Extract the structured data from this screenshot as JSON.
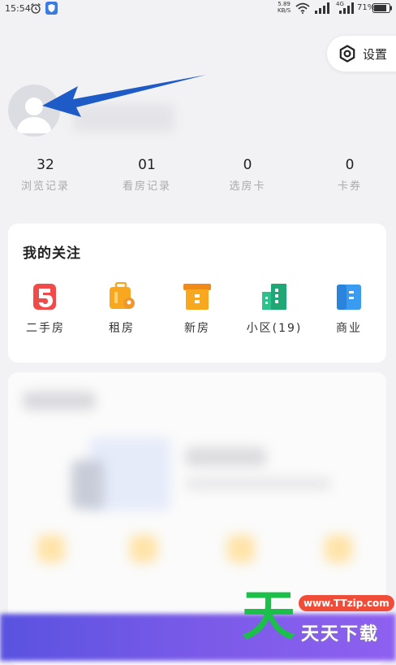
{
  "status_bar": {
    "time": "15:54",
    "net_speed_value": "5.89",
    "net_speed_unit": "KB/S",
    "network_2": "4G",
    "battery": "71%"
  },
  "header": {
    "settings_label": "设置"
  },
  "stats": [
    {
      "value": "32",
      "label": "浏览记录"
    },
    {
      "value": "01",
      "label": "看房记录"
    },
    {
      "value": "0",
      "label": "选房卡"
    },
    {
      "value": "0",
      "label": "卡券"
    }
  ],
  "follow": {
    "title": "我的关注",
    "items": [
      {
        "label": "二手房",
        "icon": "second-hand-house-icon",
        "color": "#f04a4a"
      },
      {
        "label": "租房",
        "icon": "rent-suitcase-icon",
        "color": "#f7a81e"
      },
      {
        "label": "新房",
        "icon": "new-house-box-icon",
        "color": "#f7a81e"
      },
      {
        "label": "小区(19)",
        "icon": "community-buildings-icon",
        "color": "#2cc28b"
      },
      {
        "label": "商业",
        "icon": "commercial-building-icon",
        "color": "#3a9cf0"
      }
    ]
  },
  "watermark": {
    "big_char": "天",
    "url": "www.TTzip.com",
    "text": "天天下载"
  },
  "colors": {
    "background": "#f2f2f4",
    "arrow": "#1e5bc6",
    "purple_band": "#6a56e6"
  }
}
